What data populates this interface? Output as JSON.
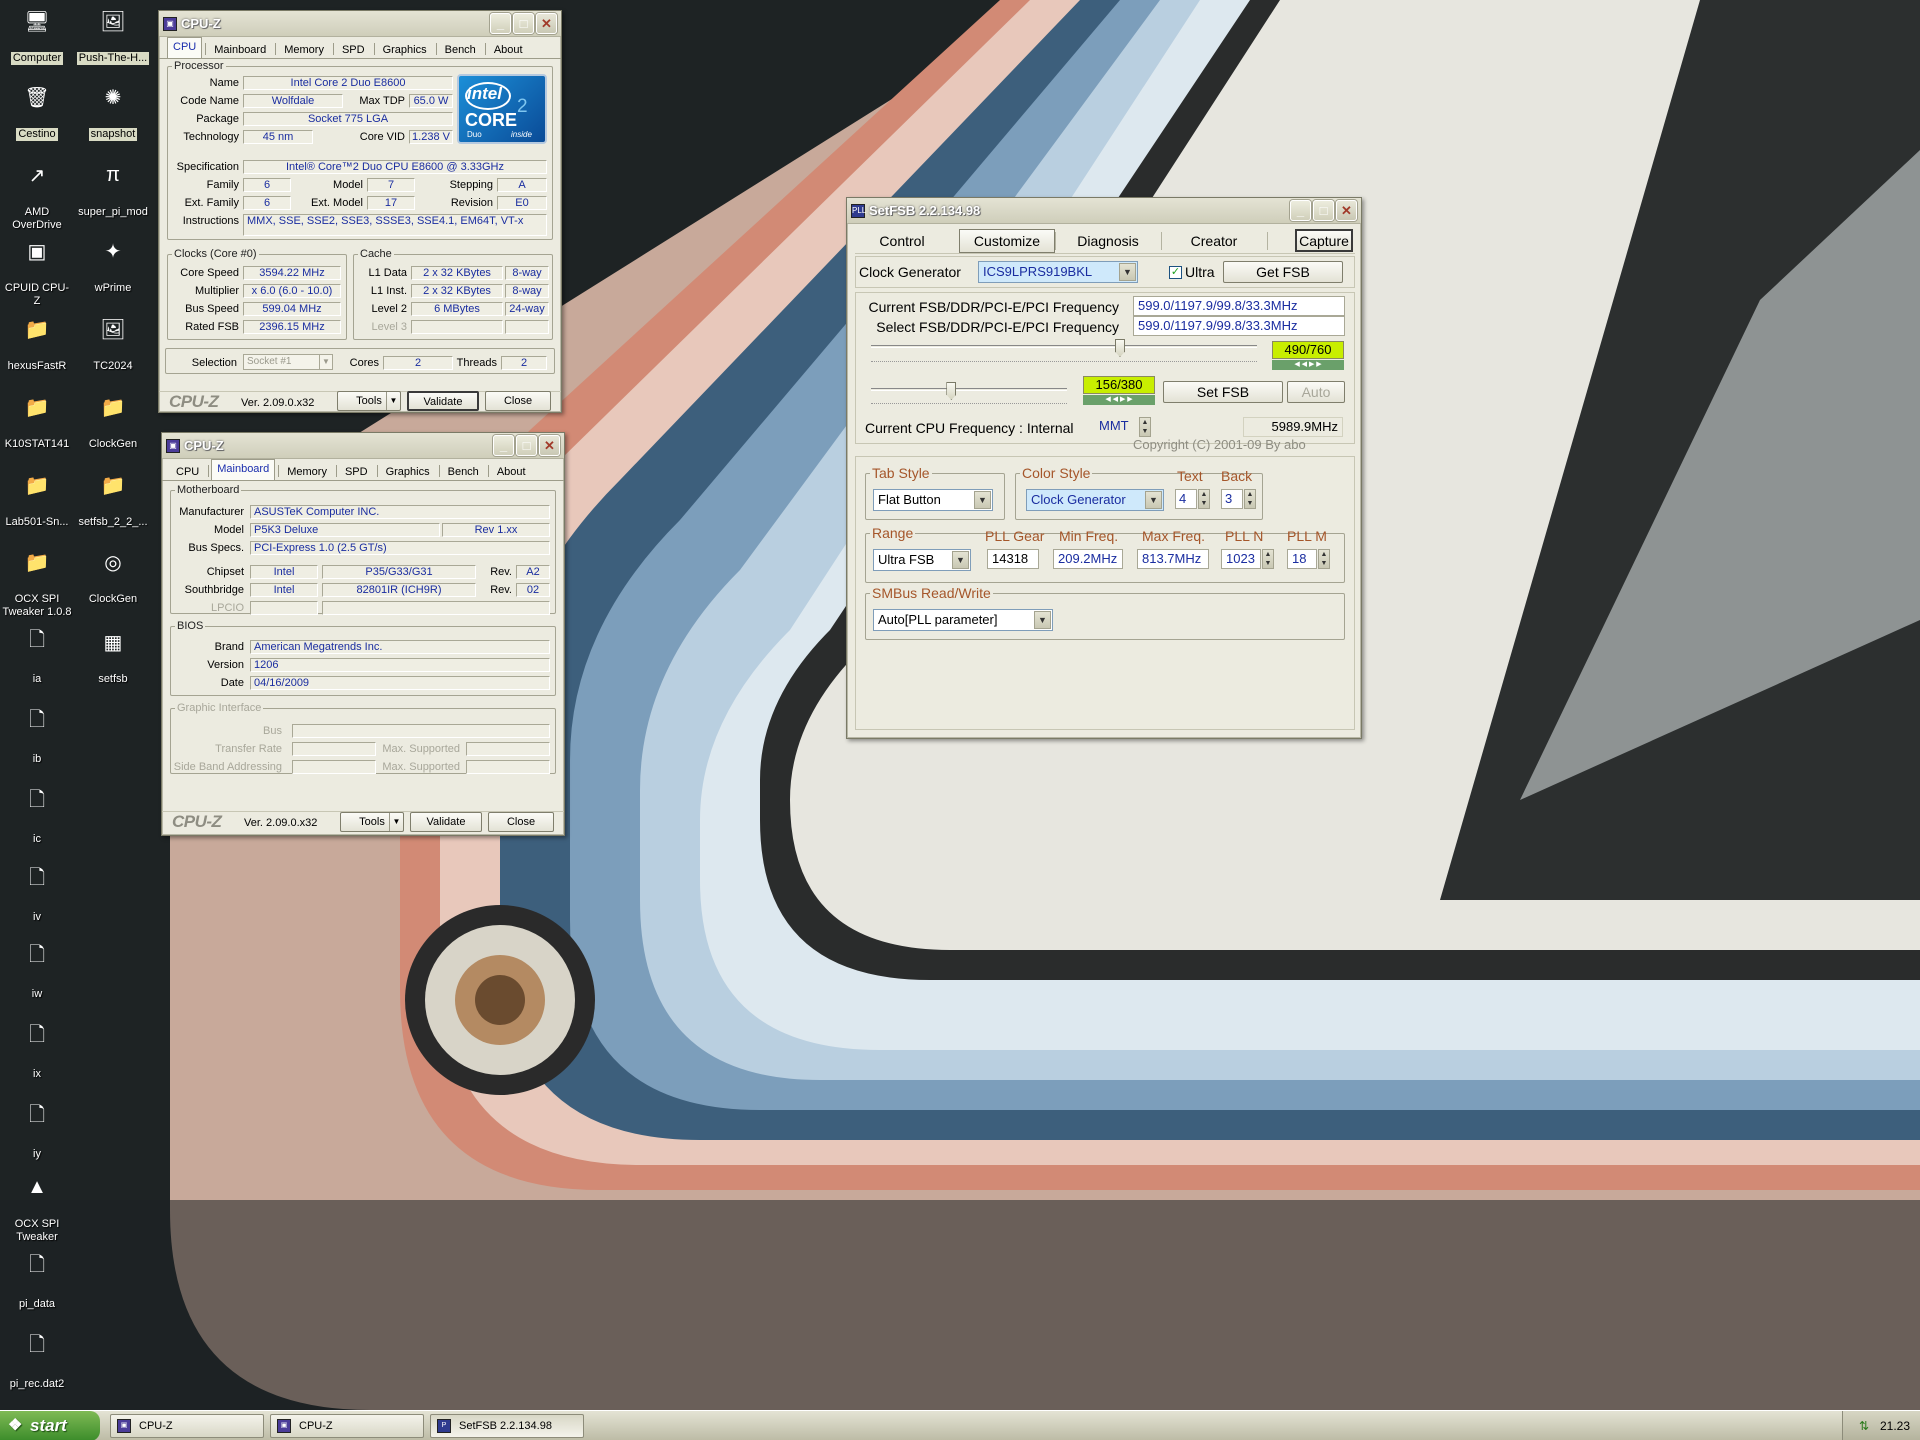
{
  "desktop_icons": [
    {
      "label": "Computer",
      "icon": "computer-icon",
      "glyph": "🖥",
      "selected": true
    },
    {
      "label": "Push-The-H...",
      "icon": "image-file-icon",
      "glyph": "🖼",
      "selected": true
    },
    {
      "label": "Cestino",
      "icon": "recycle-bin-icon",
      "glyph": "🗑",
      "selected": true
    },
    {
      "label": "snapshot",
      "icon": "snapshot-icon",
      "glyph": "✺",
      "selected": true
    },
    {
      "label": "AMD OverDrive",
      "icon": "amd-overdrive-icon",
      "glyph": "↗",
      "selected": false
    },
    {
      "label": "super_pi_mod",
      "icon": "super-pi-icon",
      "glyph": "π",
      "selected": false
    },
    {
      "label": "CPUID CPU-Z",
      "icon": "cpuz-icon",
      "glyph": "▣",
      "selected": false
    },
    {
      "label": "wPrime",
      "icon": "wprime-icon",
      "glyph": "✦",
      "selected": false
    },
    {
      "label": "hexusFastR",
      "icon": "folder-icon",
      "glyph": "📁",
      "selected": false
    },
    {
      "label": "TC2024",
      "icon": "image-file-icon",
      "glyph": "🖼",
      "selected": false
    },
    {
      "label": "K10STAT141",
      "icon": "folder-icon",
      "glyph": "📁",
      "selected": false
    },
    {
      "label": "ClockGen",
      "icon": "folder-icon",
      "glyph": "📁",
      "selected": false
    },
    {
      "label": "Lab501-Sn...",
      "icon": "folder-icon",
      "glyph": "📁",
      "selected": false
    },
    {
      "label": "setfsb_2_2_...",
      "icon": "folder-icon",
      "glyph": "📁",
      "selected": false
    },
    {
      "label": "OCX SPI Tweaker 1.0.8",
      "icon": "folder-icon",
      "glyph": "📁",
      "selected": false
    },
    {
      "label": "ClockGen",
      "icon": "clockgen-icon",
      "glyph": "◎",
      "selected": false
    },
    {
      "label": "ia",
      "icon": "file-icon",
      "glyph": "🗋",
      "selected": false
    },
    {
      "label": "setfsb",
      "icon": "setfsb-icon",
      "glyph": "▦",
      "selected": false
    },
    {
      "label": "ib",
      "icon": "file-icon",
      "glyph": "🗋",
      "selected": false
    },
    {
      "label": "ic",
      "icon": "file-icon",
      "glyph": "🗋",
      "selected": false
    },
    {
      "label": "iv",
      "icon": "file-icon",
      "glyph": "🗋",
      "selected": false
    },
    {
      "label": "iw",
      "icon": "file-icon",
      "glyph": "🗋",
      "selected": false
    },
    {
      "label": "ix",
      "icon": "file-icon",
      "glyph": "🗋",
      "selected": false
    },
    {
      "label": "iy",
      "icon": "file-icon",
      "glyph": "🗋",
      "selected": false
    },
    {
      "label": "OCX SPI Tweaker",
      "icon": "ocx-spi-icon",
      "glyph": "▲",
      "selected": false
    },
    {
      "label": "pi_data",
      "icon": "file-icon",
      "glyph": "🗋",
      "selected": false
    },
    {
      "label": "pi_rec.dat2",
      "icon": "file-icon",
      "glyph": "🗋",
      "selected": false
    }
  ],
  "cpuz1": {
    "title": "CPU-Z",
    "tabs": [
      "CPU",
      "Mainboard",
      "Memory",
      "SPD",
      "Graphics",
      "Bench",
      "About"
    ],
    "active_tab": "CPU",
    "processor_legend": "Processor",
    "name_label": "Name",
    "name": "Intel Core 2 Duo E8600",
    "codename_label": "Code Name",
    "codename": "Wolfdale",
    "maxtdp_label": "Max TDP",
    "maxtdp": "65.0 W",
    "package_label": "Package",
    "package": "Socket 775 LGA",
    "tech_label": "Technology",
    "tech": "45 nm",
    "corevid_label": "Core VID",
    "corevid": "1.238 V",
    "spec_label": "Specification",
    "spec": "Intel® Core™2 Duo CPU     E8600  @ 3.33GHz",
    "family_label": "Family",
    "family": "6",
    "model_label": "Model",
    "model": "7",
    "stepping_label": "Stepping",
    "stepping": "A",
    "extfamily_label": "Ext. Family",
    "extfamily": "6",
    "extmodel_label": "Ext. Model",
    "extmodel": "17",
    "revision_label": "Revision",
    "revision": "E0",
    "instr_label": "Instructions",
    "instr": "MMX, SSE, SSE2, SSE3, SSSE3, SSE4.1, EM64T, VT-x",
    "logo_intel": "intel",
    "logo_core": "CORE",
    "logo_sub": "Duo",
    "logo_inside": "inside",
    "clocks_legend": "Clocks (Core #0)",
    "corespeed_label": "Core Speed",
    "corespeed": "3594.22 MHz",
    "multiplier_label": "Multiplier",
    "multiplier": "x 6.0 (6.0 - 10.0)",
    "busspeed_label": "Bus Speed",
    "busspeed": "599.04 MHz",
    "ratedfsb_label": "Rated FSB",
    "ratedfsb": "2396.15 MHz",
    "cache_legend": "Cache",
    "l1d_label": "L1 Data",
    "l1d": "2 x 32 KBytes",
    "l1d_way": "8-way",
    "l1i_label": "L1 Inst.",
    "l1i": "2 x 32 KBytes",
    "l1i_way": "8-way",
    "l2_label": "Level 2",
    "l2": "6 MBytes",
    "l2_way": "24-way",
    "l3_label": "Level 3",
    "selection_label": "Selection",
    "selection": "Socket #1",
    "cores_label": "Cores",
    "cores": "2",
    "threads_label": "Threads",
    "threads": "2",
    "logo": "CPU-Z",
    "version": "Ver. 2.09.0.x32",
    "tools_btn": "Tools",
    "validate_btn": "Validate",
    "close_btn": "Close"
  },
  "cpuz2": {
    "title": "CPU-Z",
    "tabs": [
      "CPU",
      "Mainboard",
      "Memory",
      "SPD",
      "Graphics",
      "Bench",
      "About"
    ],
    "active_tab": "Mainboard",
    "mb_legend": "Motherboard",
    "manufacturer_label": "Manufacturer",
    "manufacturer": "ASUSTeK Computer INC.",
    "model_label": "Model",
    "model": "P5K3 Deluxe",
    "model_rev": "Rev 1.xx",
    "busspecs_label": "Bus Specs.",
    "busspecs": "PCI-Express 1.0 (2.5 GT/s)",
    "chipset_label": "Chipset",
    "chipset_vendor": "Intel",
    "chipset": "P35/G33/G31",
    "chipset_rev_label": "Rev.",
    "chipset_rev": "A2",
    "sb_label": "Southbridge",
    "sb_vendor": "Intel",
    "sb": "82801IR (ICH9R)",
    "sb_rev_label": "Rev.",
    "sb_rev": "02",
    "lpcio_label": "LPCIO",
    "bios_legend": "BIOS",
    "brand_label": "Brand",
    "brand": "American Megatrends Inc.",
    "version_label": "Version",
    "bios_version": "1206",
    "date_label": "Date",
    "date": "04/16/2009",
    "gi_legend": "Graphic Interface",
    "bus_label": "Bus",
    "transfer_label": "Transfer Rate",
    "maxsup_label": "Max. Supported",
    "sba_label": "Side Band Addressing",
    "maxsup2_label": "Max. Supported",
    "logo": "CPU-Z",
    "version": "Ver. 2.09.0.x32",
    "tools_btn": "Tools",
    "validate_btn": "Validate",
    "close_btn": "Close"
  },
  "setfsb": {
    "title": "SetFSB 2.2.134.98",
    "tabs": [
      "Control",
      "Customize",
      "Diagnosis",
      "Creator"
    ],
    "active_tab": "Customize",
    "capture_btn": "Capture",
    "clockgen_label": "Clock Generator",
    "clockgen": "ICS9LPRS919BKL",
    "ultra_label": "Ultra",
    "ultra_checked": true,
    "getfsb_btn": "Get FSB",
    "current_label": "Current FSB/DDR/PCI-E/PCI Frequency",
    "current": "599.0/1197.9/99.8/33.3MHz",
    "select_label": "Select FSB/DDR/PCI-E/PCI Frequency",
    "select": "599.0/1197.9/99.8/33.3MHz",
    "slider1_value": "490/760",
    "slider1_pos": 0.645,
    "slider2_value": "156/380",
    "slider2_pos": 0.41,
    "setfsb_btn": "Set FSB",
    "auto_btn": "Auto",
    "cpufreq_label": "Current CPU Frequency : Internal",
    "cpufreq_mode": "MMT",
    "cpufreq": "5989.9MHz",
    "copyright": "Copyright (C) 2001-09 By abo",
    "tabstyle_legend": "Tab Style",
    "tabstyle": "Flat Button",
    "colorstyle_legend": "Color Style",
    "colorstyle": "Clock Generator",
    "text_label": "Text",
    "text_val": "4",
    "back_label": "Back",
    "back_val": "3",
    "range_legend": "Range",
    "range": "Ultra FSB",
    "pllgear_label": "PLL Gear",
    "pllgear": "14318",
    "minfreq_label": "Min Freq.",
    "minfreq": "209.2MHz",
    "maxfreq_label": "Max Freq.",
    "maxfreq": "813.7MHz",
    "plln_label": "PLL N",
    "plln": "1023",
    "pllm_label": "PLL M",
    "pllm": "18",
    "smbus_legend": "SMBus Read/Write",
    "smbus": "Auto[PLL parameter]"
  },
  "taskbar": {
    "start": "start",
    "items": [
      "CPU-Z",
      "CPU-Z",
      "SetFSB 2.2.134.98"
    ],
    "clock": "21.23"
  }
}
